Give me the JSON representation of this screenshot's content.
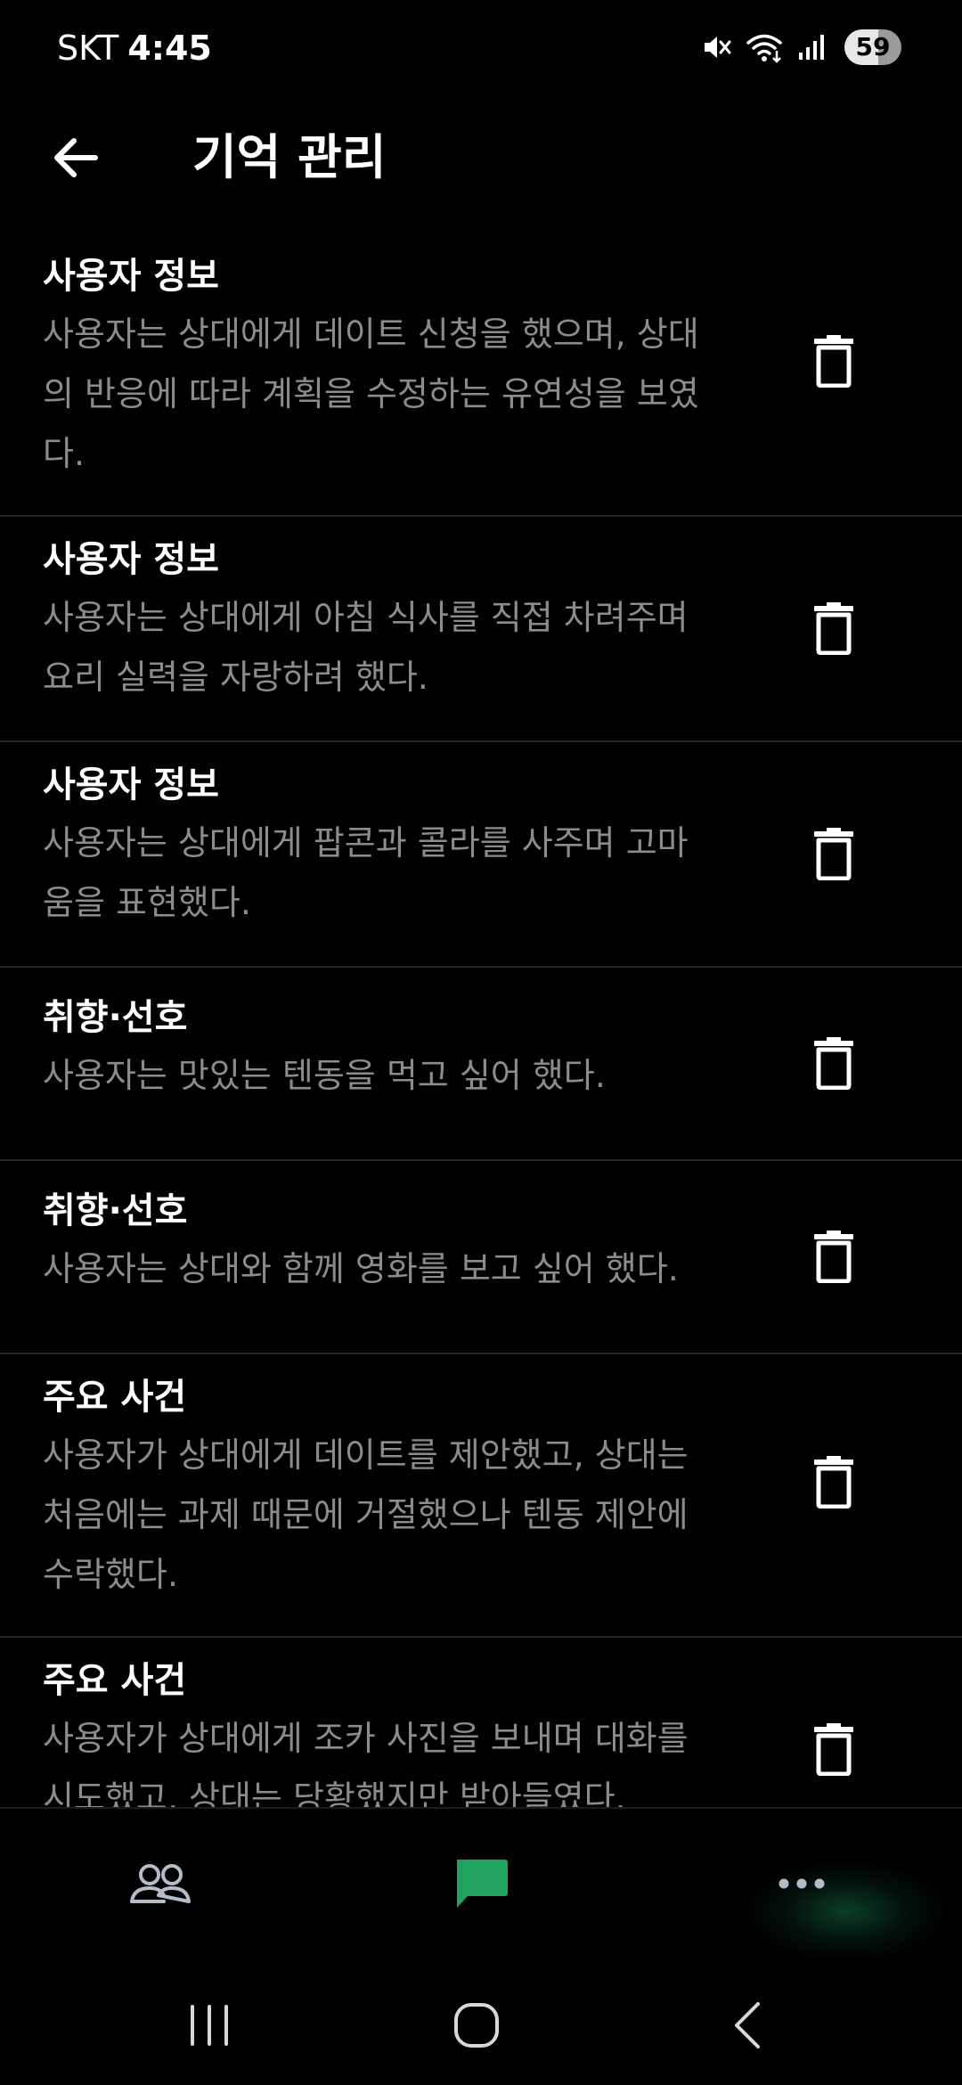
{
  "status_bar": {
    "carrier": "SKT",
    "time": "4:45",
    "battery": "59",
    "icons": [
      "mute-icon",
      "wifi-icon",
      "signal-icon"
    ]
  },
  "header": {
    "title": "기억 관리",
    "back_icon": "arrow-left-icon"
  },
  "memories": [
    {
      "category": "사용자 정보",
      "lines": [
        "사용자는 상대에게 데이트 신청을 했으며, 상대",
        "의 반응에 따라 계획을 수정하는 유연성을 보였",
        "다."
      ]
    },
    {
      "category": "사용자 정보",
      "lines": [
        "사용자는 상대에게 아침 식사를 직접 차려주며",
        "요리 실력을 자랑하려 했다."
      ]
    },
    {
      "category": "사용자 정보",
      "lines": [
        "사용자는 상대에게 팝콘과 콜라를 사주며 고마",
        "움을 표현했다."
      ]
    },
    {
      "category": "취향·선호",
      "lines": [
        "사용자는 맛있는 텐동을 먹고 싶어 했다."
      ]
    },
    {
      "category": "취향·선호",
      "lines": [
        "사용자는 상대와 함께 영화를 보고 싶어 했다."
      ]
    },
    {
      "category": "주요 사건",
      "lines": [
        "사용자가 상대에게 데이트를 제안했고, 상대는",
        "처음에는 과제 때문에 거절했으나 텐동 제안에",
        "수락했다."
      ]
    },
    {
      "category": "주요 사건",
      "lines": [
        "사용자가 상대에게 조카 사진을 보내며 대화를",
        "시도했고, 상대는 당황했지만 받아들였다."
      ]
    }
  ],
  "bottom_nav": {
    "tabs": [
      {
        "icon": "people-icon",
        "active": false
      },
      {
        "icon": "chat-bubble-icon",
        "active": true
      },
      {
        "icon": "more-dots-icon",
        "active": false
      }
    ],
    "active_color": "#1fa35f",
    "inactive_color": "#b4bcc8"
  },
  "system_nav": [
    "recent-apps-icon",
    "home-icon",
    "system-back-icon"
  ],
  "colors": {
    "background": "#000000",
    "text_primary": "#ffffff",
    "text_secondary": "#8c8c8c",
    "divider": "#262626"
  }
}
